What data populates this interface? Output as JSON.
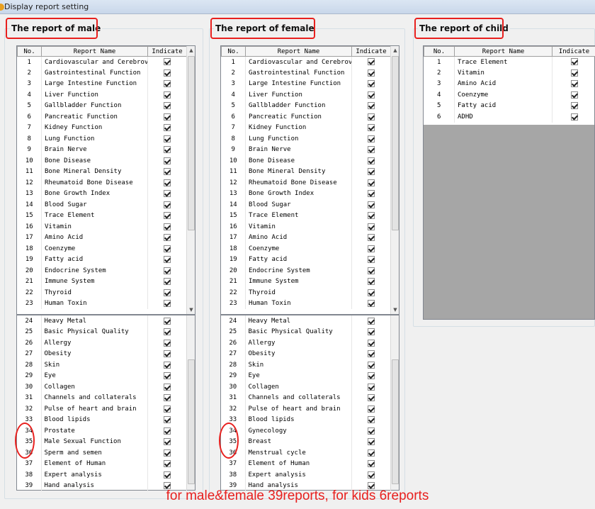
{
  "window": {
    "title": "Display report setting"
  },
  "columns": {
    "no": "No.",
    "name": "Report Name",
    "indicate": "Indicate"
  },
  "male": {
    "title": "The report of male",
    "top_rows": [
      {
        "no": "1",
        "name": "Cardiovascular and Cerebrov"
      },
      {
        "no": "2",
        "name": "Gastrointestinal Function"
      },
      {
        "no": "3",
        "name": "Large Intestine Function"
      },
      {
        "no": "4",
        "name": "Liver Function"
      },
      {
        "no": "5",
        "name": "Gallbladder Function"
      },
      {
        "no": "6",
        "name": "Pancreatic Function"
      },
      {
        "no": "7",
        "name": "Kidney Function"
      },
      {
        "no": "8",
        "name": "Lung Function"
      },
      {
        "no": "9",
        "name": "Brain Nerve"
      },
      {
        "no": "10",
        "name": "Bone Disease"
      },
      {
        "no": "11",
        "name": "Bone Mineral Density"
      },
      {
        "no": "12",
        "name": "Rheumatoid Bone Disease"
      },
      {
        "no": "13",
        "name": "Bone Growth Index"
      },
      {
        "no": "14",
        "name": "Blood Sugar"
      },
      {
        "no": "15",
        "name": "Trace Element"
      },
      {
        "no": "16",
        "name": "Vitamin"
      },
      {
        "no": "17",
        "name": "Amino Acid"
      },
      {
        "no": "18",
        "name": "Coenzyme"
      },
      {
        "no": "19",
        "name": "Fatty acid"
      },
      {
        "no": "20",
        "name": "Endocrine System"
      },
      {
        "no": "21",
        "name": "Immune System"
      },
      {
        "no": "22",
        "name": "Thyroid"
      },
      {
        "no": "23",
        "name": "Human Toxin"
      }
    ],
    "bottom_rows": [
      {
        "no": "24",
        "name": "Heavy Metal"
      },
      {
        "no": "25",
        "name": "Basic Physical Quality"
      },
      {
        "no": "26",
        "name": "Allergy"
      },
      {
        "no": "27",
        "name": "Obesity"
      },
      {
        "no": "28",
        "name": "Skin"
      },
      {
        "no": "29",
        "name": "Eye"
      },
      {
        "no": "30",
        "name": "Collagen"
      },
      {
        "no": "31",
        "name": "Channels and collaterals"
      },
      {
        "no": "32",
        "name": "Pulse of heart and brain"
      },
      {
        "no": "33",
        "name": "Blood lipids"
      },
      {
        "no": "34",
        "name": "Prostate"
      },
      {
        "no": "35",
        "name": "Male Sexual Function"
      },
      {
        "no": "36",
        "name": "Sperm and semen"
      },
      {
        "no": "37",
        "name": "Element of Human"
      },
      {
        "no": "38",
        "name": "Expert analysis"
      },
      {
        "no": "39",
        "name": "Hand analysis"
      }
    ]
  },
  "female": {
    "title": "The report of female",
    "top_rows": [
      {
        "no": "1",
        "name": "Cardiovascular and Cerebrov"
      },
      {
        "no": "2",
        "name": "Gastrointestinal Function"
      },
      {
        "no": "3",
        "name": "Large Intestine Function"
      },
      {
        "no": "4",
        "name": "Liver Function"
      },
      {
        "no": "5",
        "name": "Gallbladder Function"
      },
      {
        "no": "6",
        "name": "Pancreatic Function"
      },
      {
        "no": "7",
        "name": "Kidney Function"
      },
      {
        "no": "8",
        "name": "Lung Function"
      },
      {
        "no": "9",
        "name": "Brain Nerve"
      },
      {
        "no": "10",
        "name": "Bone Disease"
      },
      {
        "no": "11",
        "name": "Bone Mineral Density"
      },
      {
        "no": "12",
        "name": "Rheumatoid Bone Disease"
      },
      {
        "no": "13",
        "name": "Bone Growth Index"
      },
      {
        "no": "14",
        "name": "Blood Sugar"
      },
      {
        "no": "15",
        "name": "Trace Element"
      },
      {
        "no": "16",
        "name": "Vitamin"
      },
      {
        "no": "17",
        "name": "Amino Acid"
      },
      {
        "no": "18",
        "name": "Coenzyme"
      },
      {
        "no": "19",
        "name": "Fatty acid"
      },
      {
        "no": "20",
        "name": "Endocrine System"
      },
      {
        "no": "21",
        "name": "Immune System"
      },
      {
        "no": "22",
        "name": "Thyroid"
      },
      {
        "no": "23",
        "name": "Human Toxin"
      }
    ],
    "bottom_rows": [
      {
        "no": "24",
        "name": "Heavy Metal"
      },
      {
        "no": "25",
        "name": "Basic Physical Quality"
      },
      {
        "no": "26",
        "name": "Allergy"
      },
      {
        "no": "27",
        "name": "Obesity"
      },
      {
        "no": "28",
        "name": "Skin"
      },
      {
        "no": "29",
        "name": "Eye"
      },
      {
        "no": "30",
        "name": "Collagen"
      },
      {
        "no": "31",
        "name": "Channels and collaterals"
      },
      {
        "no": "32",
        "name": "Pulse of heart and brain"
      },
      {
        "no": "33",
        "name": "Blood lipids"
      },
      {
        "no": "34",
        "name": "Gynecology"
      },
      {
        "no": "35",
        "name": "Breast"
      },
      {
        "no": "36",
        "name": "Menstrual cycle"
      },
      {
        "no": "37",
        "name": "Element of Human"
      },
      {
        "no": "38",
        "name": "Expert analysis"
      },
      {
        "no": "39",
        "name": "Hand analysis"
      }
    ]
  },
  "child": {
    "title": "The report of child",
    "rows": [
      {
        "no": "1",
        "name": "Trace Element"
      },
      {
        "no": "2",
        "name": "Vitamin"
      },
      {
        "no": "3",
        "name": "Amino Acid"
      },
      {
        "no": "4",
        "name": "Coenzyme"
      },
      {
        "no": "5",
        "name": "Fatty acid"
      },
      {
        "no": "6",
        "name": "ADHD"
      }
    ]
  },
  "caption": "for male&female 39reports, for kids 6reports",
  "colors": {
    "highlight": "#e8201e",
    "empty_grid": "#a6a6a6"
  },
  "icons": {
    "checked": "checkbox-checked-icon",
    "up": "scroll-up-arrow-icon",
    "down": "scroll-down-arrow-icon"
  }
}
